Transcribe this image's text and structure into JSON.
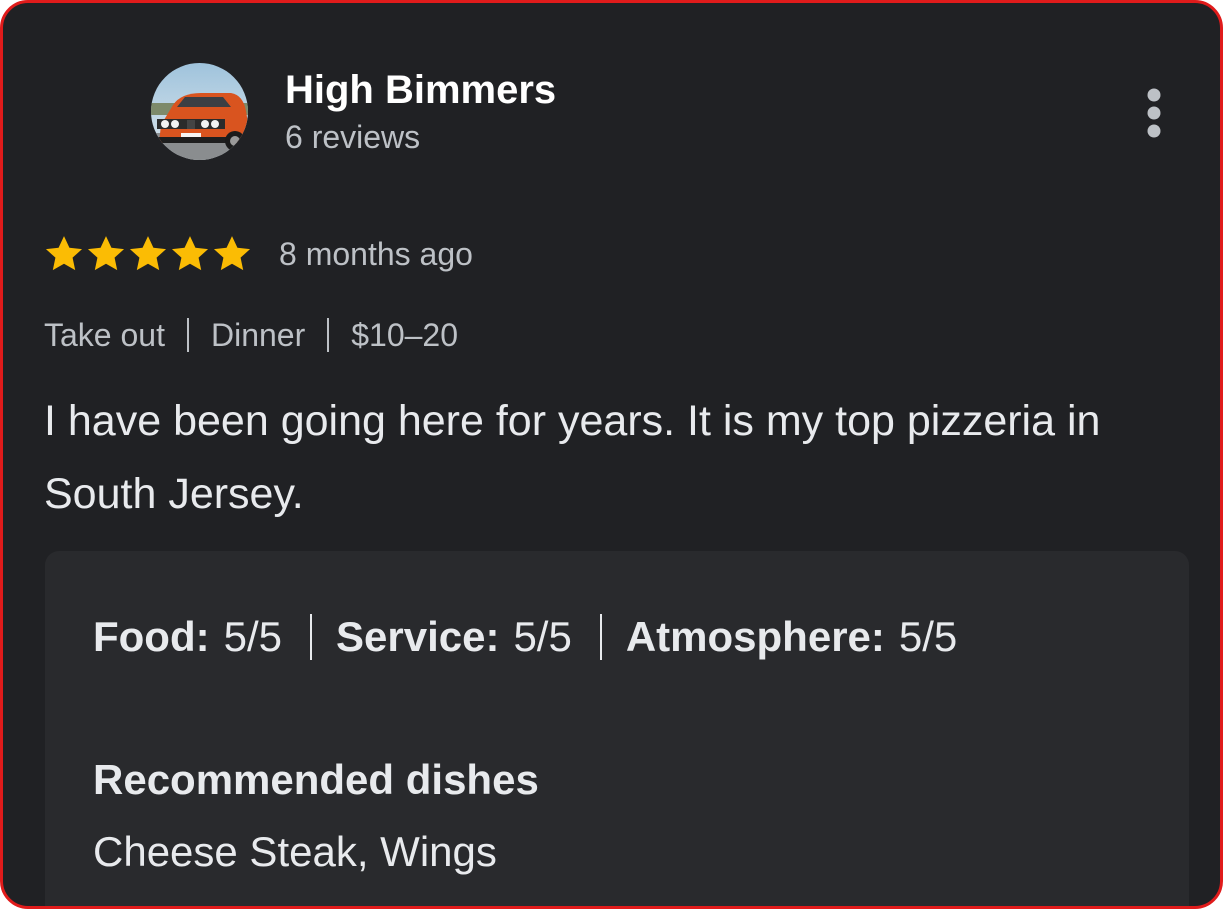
{
  "review": {
    "author": {
      "name": "High Bimmers",
      "meta": "6 reviews",
      "avatar_icon": "user-avatar-car-photo"
    },
    "more_icon": "more-vert-icon",
    "rating": 5,
    "rating_max": 5,
    "star_color": "#fbbc04",
    "time_ago": "8 months ago",
    "tags": [
      "Take out",
      "Dinner",
      "$10–20"
    ],
    "text": "I have been going here for years. It is my top pizzeria in South Jersey.",
    "details": {
      "sub_ratings": [
        {
          "label": "Food:",
          "value": "5/5"
        },
        {
          "label": "Service:",
          "value": "5/5"
        },
        {
          "label": "Atmosphere:",
          "value": "5/5"
        }
      ],
      "recommended_heading": "Recommended dishes",
      "recommended_dishes": "Cheese Steak, Wings"
    }
  },
  "colors": {
    "background": "#202124",
    "panel": "#292a2d",
    "frame_border": "#e01b1b",
    "text_primary": "#e8eaed",
    "text_secondary": "#bdc1c6"
  }
}
